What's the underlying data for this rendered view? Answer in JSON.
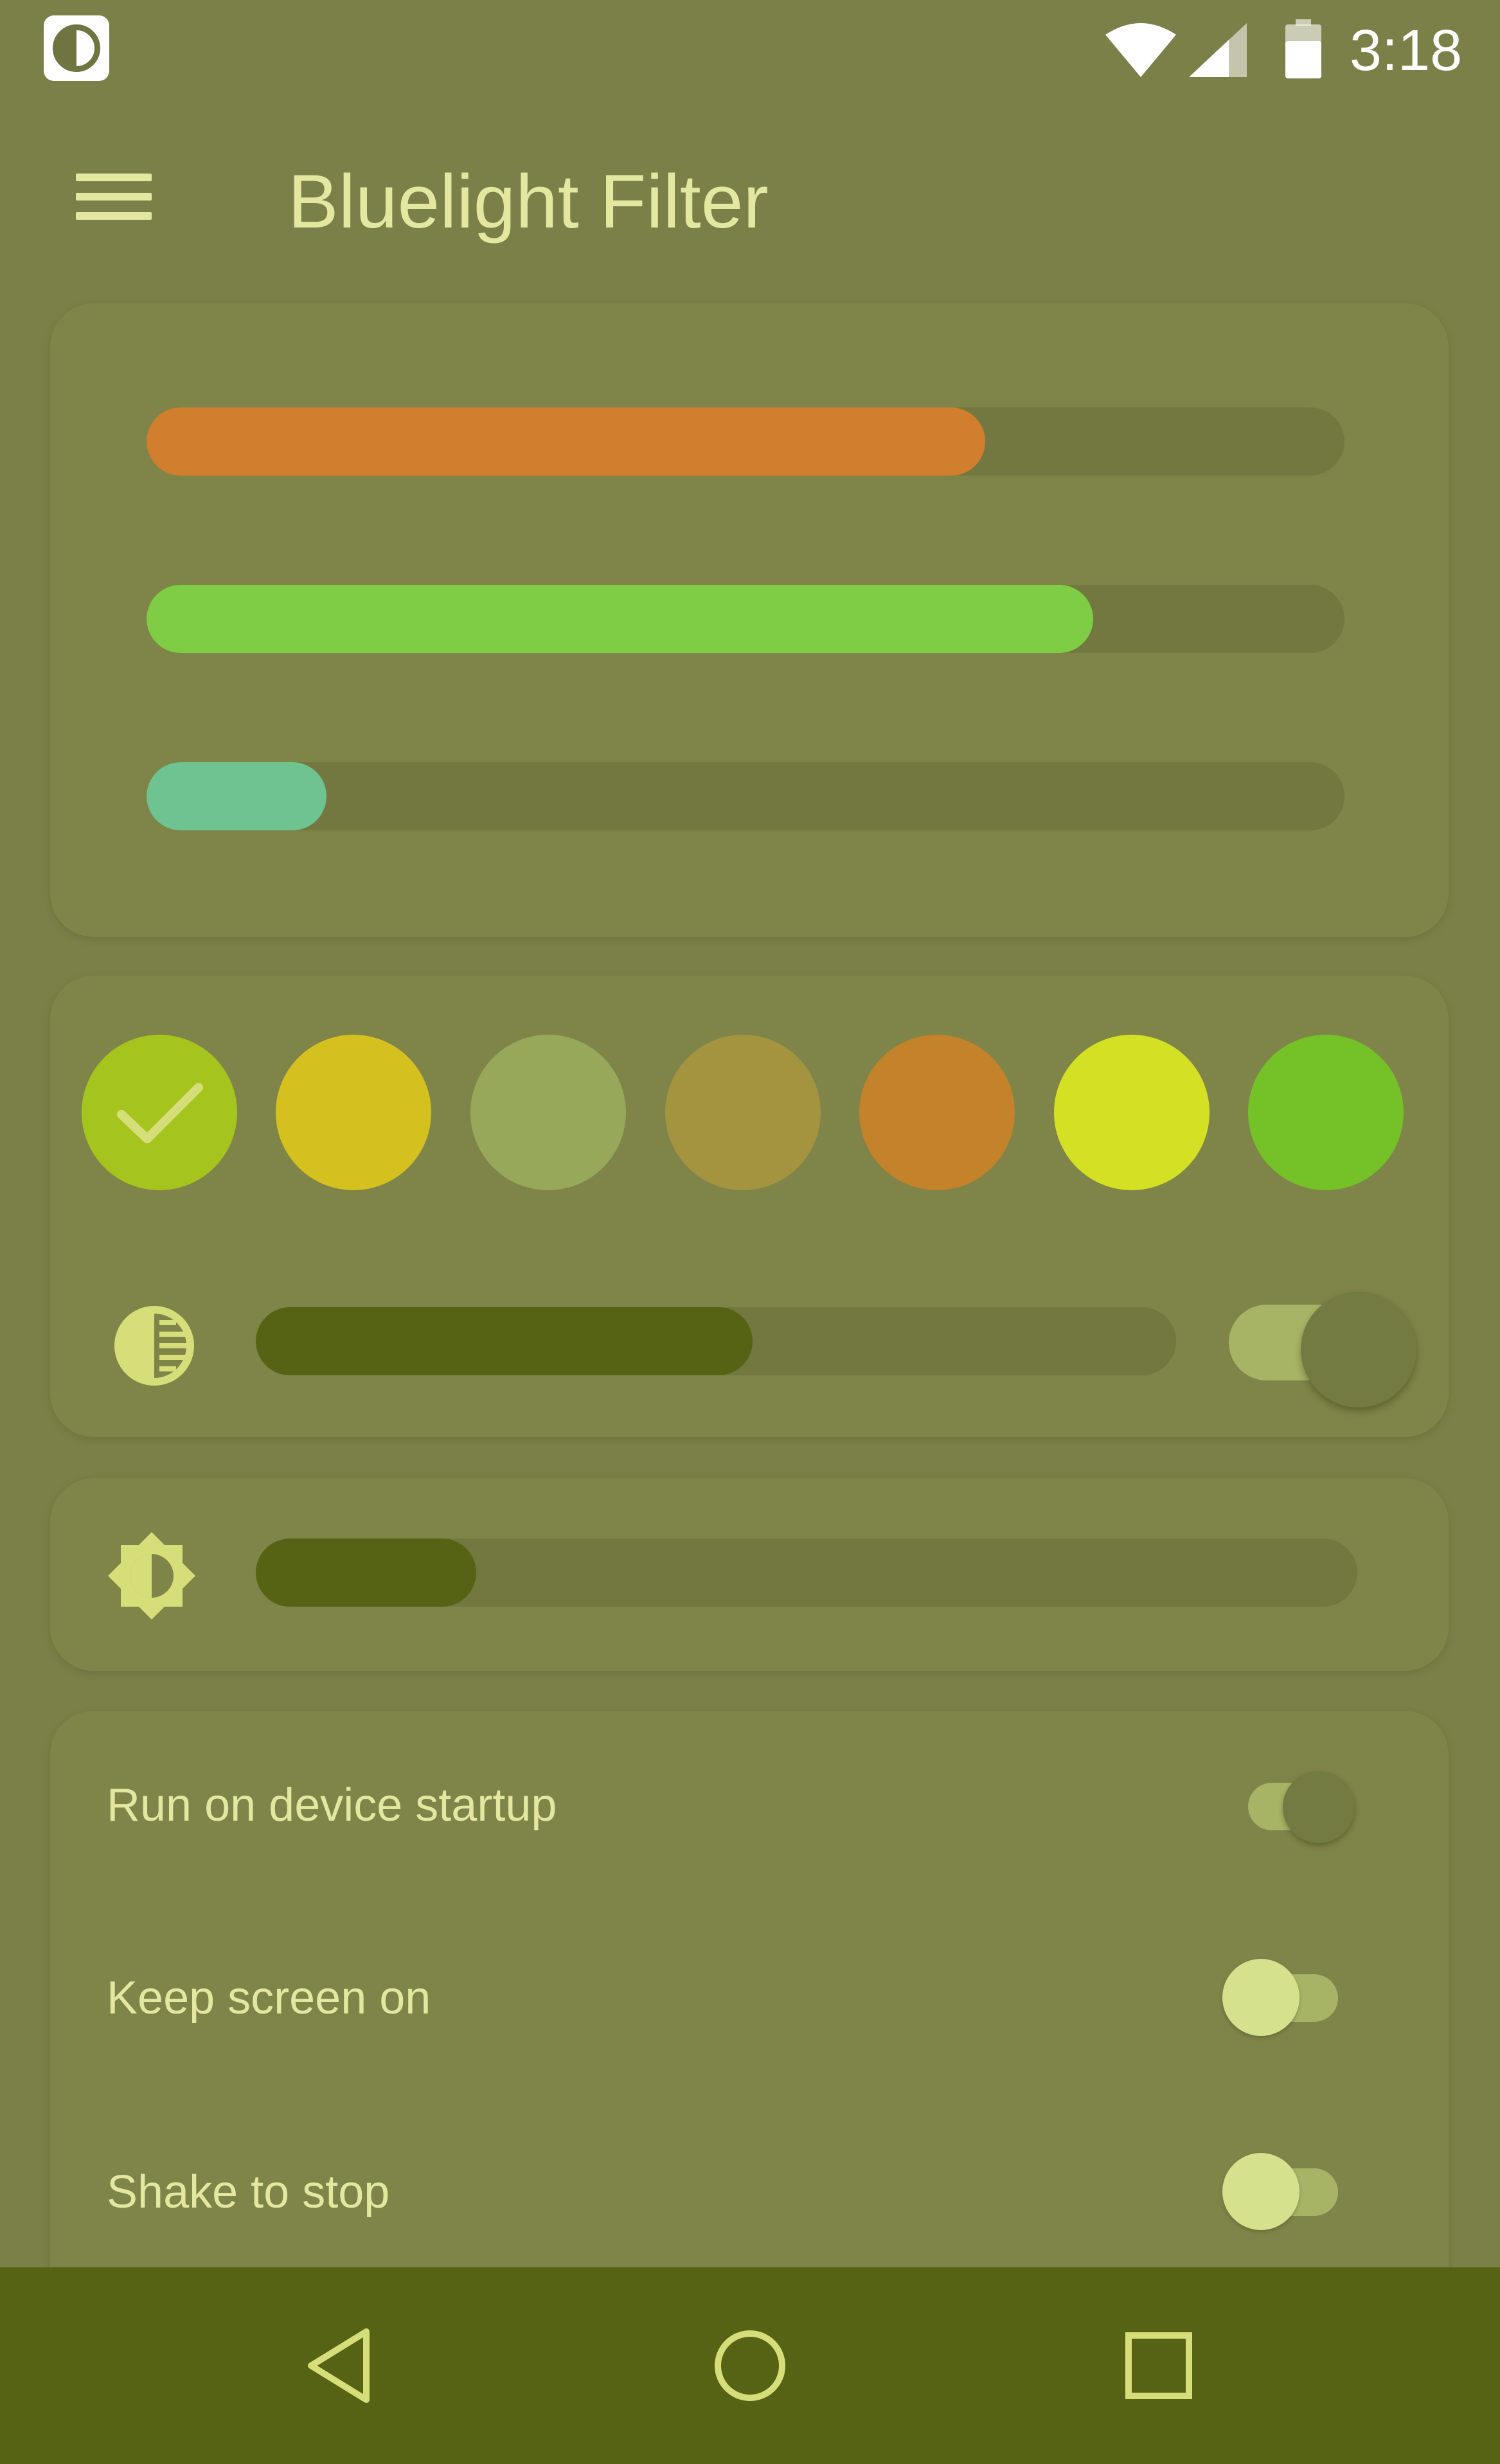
{
  "status_bar": {
    "time": "3:18",
    "wifi_icon": "wifi-icon",
    "signal_icon": "cell-signal-icon",
    "battery_icon": "battery-icon",
    "logo_icon": "filter-app-icon"
  },
  "app_bar": {
    "menu_icon": "hamburger-menu-icon",
    "title": "Bluelight Filter"
  },
  "rgb_sliders": {
    "red": {
      "level": 0.7,
      "color": "#d17e2e"
    },
    "green": {
      "level": 0.79,
      "color": "#7fcd44"
    },
    "blue": {
      "level": 0.15,
      "color": "#6fc391"
    }
  },
  "color_presets": {
    "selected_index": 0,
    "colors": [
      "#a6c41e",
      "#d4c01e",
      "#98a85a",
      "#a49440",
      "#c4822a",
      "#d4e024",
      "#74c228"
    ]
  },
  "intensity": {
    "icon": "contrast-icon",
    "level": 0.54,
    "fill_color": "#566214",
    "toggle_on": true
  },
  "brightness": {
    "icon": "brightness-icon",
    "level": 0.2,
    "fill_color": "#566214"
  },
  "settings": [
    {
      "label": "Run on device startup",
      "on": true
    },
    {
      "label": "Keep screen on",
      "on": false
    },
    {
      "label": "Shake to stop",
      "on": false
    }
  ],
  "nav_bar": {
    "back_icon": "back-icon",
    "home_icon": "home-icon",
    "recents_icon": "recents-icon"
  }
}
